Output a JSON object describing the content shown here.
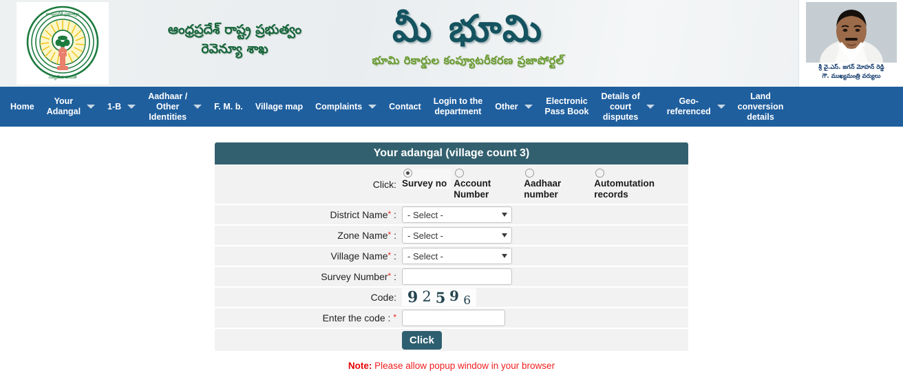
{
  "header": {
    "emblem_alt": "andhra-pradesh-state-emblem",
    "gov_line1": "ఆంధ్రప్రదేశ్ రాష్ట్ర ప్రభుత్వం",
    "gov_line2": "రెవెన్యూ శాఖ",
    "title": "మీ భూమి",
    "subtitle": "భూమి రికార్డుల కంప్యూటరీకరణ ప్రజాపోర్టల్",
    "cm_name": "శ్రీ వై.ఎస్. జగన్ మోహన్ రెడ్డి",
    "cm_designation": "గౌ. ముఖ్యమంత్రి వర్యులు",
    "bg_color": "#eceff1",
    "title_color": "#14535f",
    "subtitle_color": "#6a9c2f",
    "gov_text_color": "#16653a"
  },
  "nav": {
    "bg_color": "#1f5f9e",
    "items": [
      {
        "label": "Home",
        "caret": false
      },
      {
        "label": "Your\nAdangal",
        "caret": true
      },
      {
        "label": "1-B",
        "caret": true
      },
      {
        "label": "Aadhaar /\nOther\nIdentities",
        "caret": true
      },
      {
        "label": "F. M. b.",
        "caret": false
      },
      {
        "label": "Village map",
        "caret": false
      },
      {
        "label": "Complaints",
        "caret": true
      },
      {
        "label": "Contact",
        "caret": false
      },
      {
        "label": "Login to the\ndepartment",
        "caret": false
      },
      {
        "label": "Other",
        "caret": true
      },
      {
        "label": "Electronic\nPass Book",
        "caret": false
      },
      {
        "label": "Details of\ncourt\ndisputes",
        "caret": true
      },
      {
        "label": "Geo-\nreferenced",
        "caret": true
      },
      {
        "label": "Land\nconversion\ndetails",
        "caret": false
      }
    ]
  },
  "panel": {
    "title": "Your adangal (village count 3)",
    "header_color": "#33606f",
    "click_label": "Click:",
    "radio_options": [
      {
        "label": "Survey no",
        "selected": true
      },
      {
        "label": "Account Number",
        "selected": false
      },
      {
        "label": "Aadhaar number",
        "selected": false
      },
      {
        "label": "Automutation records",
        "selected": false
      }
    ],
    "fields": [
      {
        "label": "District Name",
        "required": true,
        "type": "select",
        "value": "- Select -"
      },
      {
        "label": "Zone Name",
        "required": true,
        "type": "select",
        "value": "- Select -"
      },
      {
        "label": "Village Name",
        "required": true,
        "type": "select",
        "value": "- Select -"
      },
      {
        "label": "Survey Number",
        "required": true,
        "type": "text",
        "value": "",
        "placeholder": ""
      }
    ],
    "code_label": "Code:",
    "captcha_digits": [
      "9",
      "2",
      "5",
      "9",
      "6"
    ],
    "captcha_value": "92596",
    "enter_code_label": "Enter the code :",
    "enter_code_value": "",
    "enter_code_placeholder": "",
    "submit_label": "Click",
    "submit_color": "#2e5f70"
  },
  "note": {
    "prefix": "Note:",
    "text": " Please allow popup window in your browser",
    "color": "#f01e1e"
  }
}
